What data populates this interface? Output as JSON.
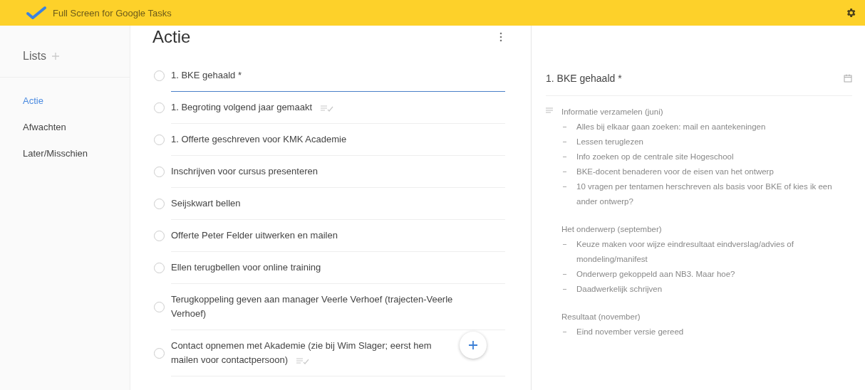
{
  "app_bar": {
    "title": "Full Screen for Google Tasks"
  },
  "sidebar": {
    "heading": "Lists",
    "items": [
      {
        "label": "Actie",
        "selected": true
      },
      {
        "label": "Afwachten",
        "selected": false
      },
      {
        "label": "Later/Misschien",
        "selected": false
      }
    ]
  },
  "task_list": {
    "title": "Actie",
    "tasks": [
      {
        "text": "1. BKE gehaald *",
        "selected": true,
        "checked": false,
        "has_notes": false
      },
      {
        "text": "1. Begroting volgend jaar gemaakt",
        "selected": false,
        "checked": false,
        "has_notes": true
      },
      {
        "text": "1. Offerte geschreven voor KMK Academie",
        "selected": false,
        "checked": false,
        "has_notes": false
      },
      {
        "text": "Inschrijven voor cursus presenteren",
        "selected": false,
        "checked": false,
        "has_notes": false
      },
      {
        "text": "Seijskwart bellen",
        "selected": false,
        "checked": false,
        "has_notes": false
      },
      {
        "text": "Offerte Peter Felder uitwerken en mailen",
        "selected": false,
        "checked": false,
        "has_notes": false
      },
      {
        "text": "Ellen terugbellen voor online training",
        "selected": false,
        "checked": false,
        "has_notes": false
      },
      {
        "text": "Terugkoppeling geven aan manager Veerle Verhoef (trajecten-Veerle Verhoef)",
        "selected": false,
        "checked": false,
        "has_notes": false
      },
      {
        "text": "Contact opnemen met Akademie (zie bij Wim Slager; eerst hem mailen voor contactpersoon)",
        "selected": false,
        "checked": false,
        "has_notes": true
      }
    ]
  },
  "details": {
    "title": "1. BKE gehaald *",
    "sections": [
      {
        "heading": "Informatie verzamelen (juni)",
        "items": [
          "Alles bij elkaar gaan zoeken: mail en aantekeningen",
          "Lessen teruglezen",
          "Info zoeken op de centrale site Hogeschool",
          "BKE-docent benaderen voor de eisen van het ontwerp",
          "10 vragen per tentamen herschreven als basis voor BKE of kies ik een ander ontwerp?"
        ]
      },
      {
        "heading": "Het onderwerp (september)",
        "items": [
          "Keuze maken voor wijze eindresultaat eindverslag/advies of mondeling/manifest",
          "Onderwerp gekoppeld aan NB3. Maar hoe?",
          "Daadwerkelijk schrijven"
        ]
      },
      {
        "heading": "Resultaat (november)",
        "items": [
          "Eind november versie gereed"
        ]
      }
    ]
  }
}
